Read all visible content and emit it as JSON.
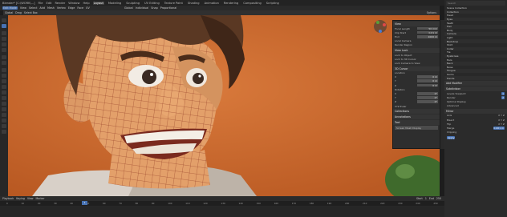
{
  "topbar": {
    "menus": [
      "Blender* [C:\\WORK\\...]",
      "File",
      "Edit",
      "Render",
      "Window",
      "Help"
    ],
    "workspaces": [
      "Layout",
      "Modeling",
      "Sculpting",
      "UV Editing",
      "Texture Paint",
      "Shading",
      "Animation",
      "Rendering",
      "Compositing",
      "Scripting"
    ],
    "active_workspace": "Layout",
    "scene_label": "Scene",
    "layer_label": "View Layer"
  },
  "toolbar2": {
    "mode": "Edit Mode",
    "items": [
      "View",
      "Select",
      "Add",
      "Mesh",
      "Vertex",
      "Edge",
      "Face",
      "UV"
    ],
    "orientation": "Global",
    "pivot": "Individual",
    "snap": "Snap",
    "proportional": "Proportional"
  },
  "header3": {
    "items": [
      "Global",
      "Drag",
      "Select Box",
      "Options"
    ]
  },
  "npanel": {
    "view_header": "View",
    "focal_length_label": "Focal Length",
    "focal_length": "50 mm",
    "clip_start_label": "Clip Start",
    "clip_start": "0.01 m",
    "clip_end_label": "End",
    "clip_end": "1000 m",
    "local_camera": "Local Camera",
    "render_region": "Render Region",
    "view_lock_header": "View Lock",
    "lock_object": "Lock to Object",
    "lock_cursor": "Lock to 3D Cursor",
    "lock_camera": "Lock Camera to View",
    "cursor_header": "3D Cursor",
    "location_label": "Location",
    "loc_x": "0 m",
    "loc_y": "0 m",
    "loc_z": "0 m",
    "rotation_label": "Rotation",
    "rot_x": "0°",
    "rot_y": "0°",
    "rot_z": "0°",
    "rot_mode": "XYZ Euler",
    "collections_header": "Collections",
    "annotations_header": "Annotations",
    "tool_header": "Tool",
    "footer_text": "Screen Mesh Display"
  },
  "outliner": {
    "search_placeholder": "Search",
    "rows": [
      "Scene Collection",
      "Collection",
      "Head",
      "Eyes",
      "Teeth",
      "Hair",
      "Body",
      "Camera",
      "Light",
      "Backdrop",
      "Shirt",
      "Collar",
      "Tie",
      "Eyebrows",
      "Ears",
      "Neck",
      "Nose",
      "Tongue",
      "Gums",
      "Hands"
    ]
  },
  "props": {
    "modifier_header": "Add Modifier",
    "subsurf": "Subdivision",
    "levels_label": "Levels Viewport",
    "levels_val": "1",
    "render_label": "Render",
    "render_val": "2",
    "optimal": "Optimal Display",
    "advanced": "Advanced",
    "mirror_header": "Mirror",
    "axis_label": "Axis",
    "bisect_label": "Bisect",
    "flip_label": "Flip",
    "merge_label": "Merge",
    "merge_val": "0.001 m",
    "clipping": "Clipping",
    "apply": "Apply"
  },
  "timeline": {
    "items": [
      "Playback",
      "Keying",
      "View",
      "Marker"
    ],
    "frame": "1",
    "start_label": "Start",
    "start": "1",
    "end_label": "End",
    "end": "250",
    "ticks": [
      "0",
      "10",
      "20",
      "30",
      "40",
      "50",
      "60",
      "70",
      "80",
      "90",
      "100",
      "110",
      "120",
      "130",
      "140",
      "150",
      "160",
      "170",
      "180",
      "190",
      "200",
      "210",
      "220",
      "230",
      "240",
      "250"
    ]
  },
  "colors": {
    "viewport_bg": "#c9682e",
    "accent": "#4772b3",
    "skin": "#e3a06a",
    "hair": "#5a3823",
    "wire": "#8a2f1e"
  }
}
